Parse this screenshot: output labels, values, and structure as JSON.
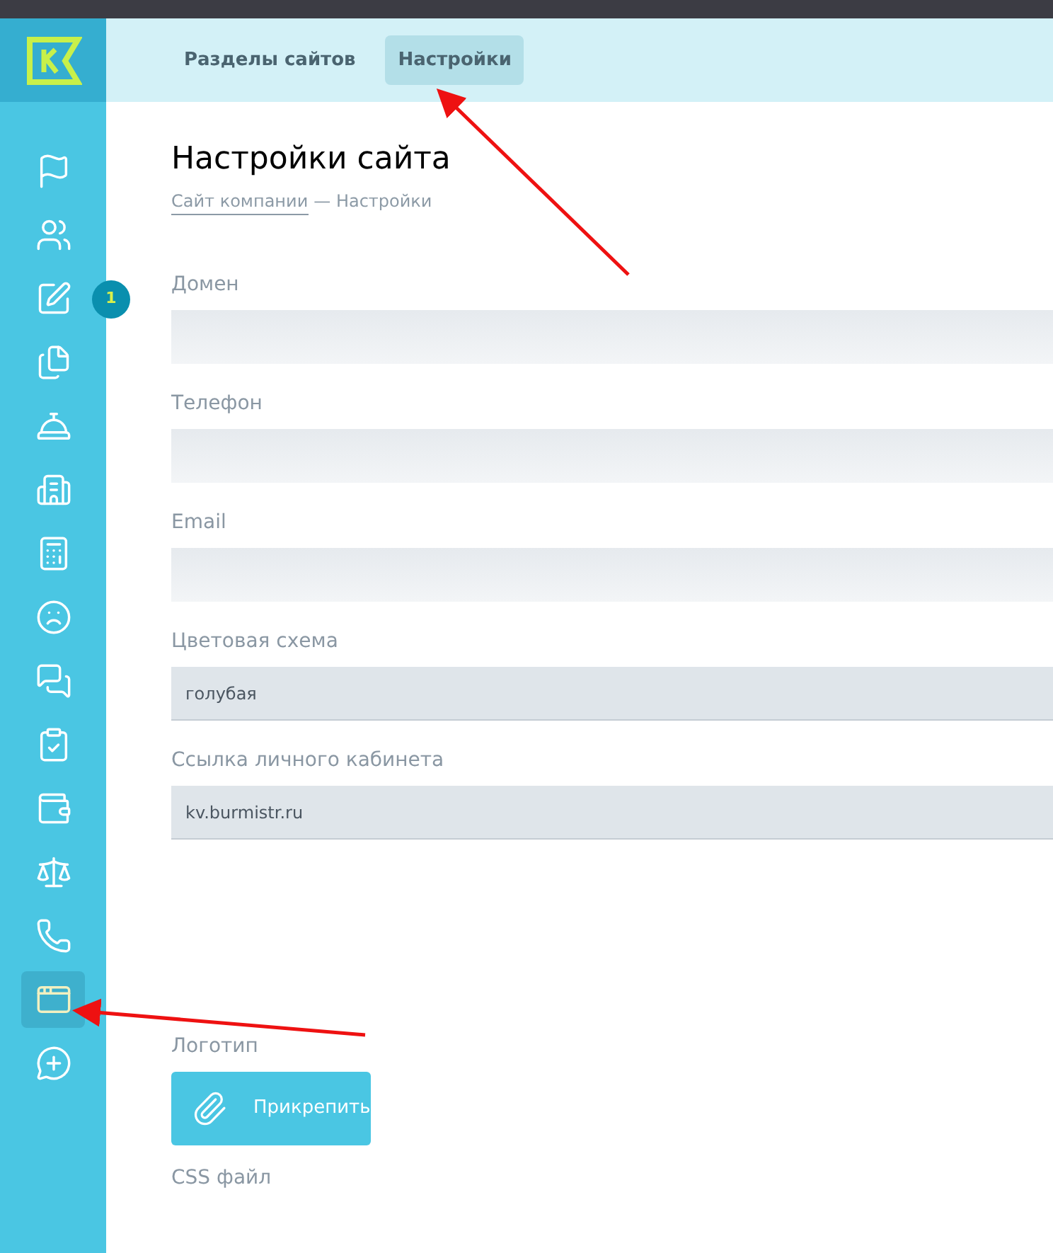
{
  "top_tabs": [
    {
      "label": "Разделы сайтов",
      "selected": false
    },
    {
      "label": "Настройки",
      "selected": true
    }
  ],
  "sidebar": {
    "items": [
      {
        "kind": "flag",
        "selected": false
      },
      {
        "kind": "people",
        "selected": false
      },
      {
        "kind": "edit",
        "selected": false,
        "badge": "1"
      },
      {
        "kind": "documents",
        "selected": false
      },
      {
        "kind": "bell",
        "selected": false
      },
      {
        "kind": "building",
        "selected": false
      },
      {
        "kind": "calculator",
        "selected": false
      },
      {
        "kind": "sad",
        "selected": false
      },
      {
        "kind": "meeting",
        "selected": false
      },
      {
        "kind": "clipboard",
        "selected": false
      },
      {
        "kind": "wallet",
        "selected": false
      },
      {
        "kind": "scales",
        "selected": false
      },
      {
        "kind": "phone",
        "selected": false
      },
      {
        "kind": "website",
        "selected": true
      },
      {
        "kind": "chat-plus",
        "selected": false
      }
    ]
  },
  "page": {
    "title": "Настройки сайта",
    "breadcrumb": [
      {
        "label": "Сайт компании",
        "kind": "link"
      },
      {
        "label": "— Настройки",
        "kind": "text"
      }
    ]
  },
  "fields": [
    {
      "label": "Домен",
      "kind": "input"
    },
    {
      "label": "Телефон",
      "kind": "input"
    },
    {
      "label": "Email",
      "kind": "input"
    },
    {
      "label": "Цветовая схема",
      "kind": "select",
      "value": "голубая"
    },
    {
      "label": "Ссылка личного кабинета",
      "kind": "select",
      "value": "kv.burmistr.ru"
    }
  ],
  "logo": {
    "label": "Логотип",
    "button": "Прикрепить"
  },
  "css_label": "CSS файл"
}
